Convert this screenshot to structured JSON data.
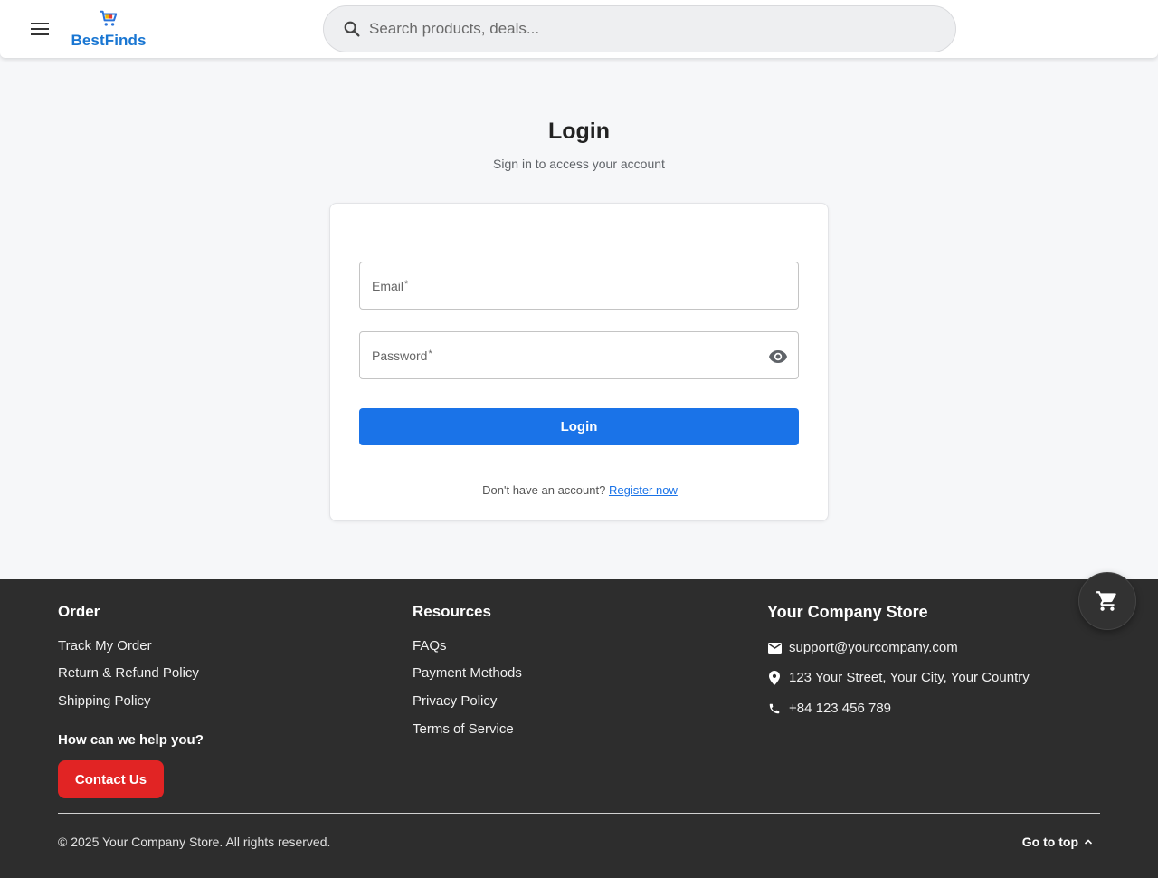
{
  "header": {
    "brand": "BestFinds",
    "search_placeholder": "Search products, deals..."
  },
  "page": {
    "title": "Login",
    "subtitle": "Sign in to access your account"
  },
  "form": {
    "email_label": "Email",
    "password_label": "Password",
    "required_mark": "*",
    "login_button": "Login",
    "register_prompt": "Don't have an account?",
    "register_link": "Register now"
  },
  "footer": {
    "order": {
      "title": "Order",
      "links": [
        "Track My Order",
        "Return & Refund Policy",
        "Shipping Policy"
      ]
    },
    "help": {
      "title": "How can we help you?",
      "button": "Contact Us"
    },
    "resources": {
      "title": "Resources",
      "links": [
        "FAQs",
        "Payment Methods",
        "Privacy Policy",
        "Terms of Service"
      ]
    },
    "company": {
      "title": "Your Company Store",
      "email": "support@yourcompany.com",
      "address": "123 Your Street, Your City, Your Country",
      "phone": "+84 123 456 789"
    },
    "copyright": "© 2025 Your Company Store. All rights reserved.",
    "go_to_top": "Go to top"
  },
  "icons": {
    "menu": "menu-icon",
    "logo": "shopping-cart-icon",
    "search": "search-icon",
    "visibility": "eye-icon",
    "email": "mail-icon",
    "location": "location-pin-icon",
    "phone": "phone-icon",
    "go_top": "chevron-up-icon",
    "fab": "shopping-cart-icon"
  },
  "colors": {
    "brand": "#1976d2",
    "primary_button": "#1a73e8",
    "contact_button": "#e12424",
    "footer_bg": "#2d2d2d",
    "page_bg": "#f6f7f9"
  }
}
